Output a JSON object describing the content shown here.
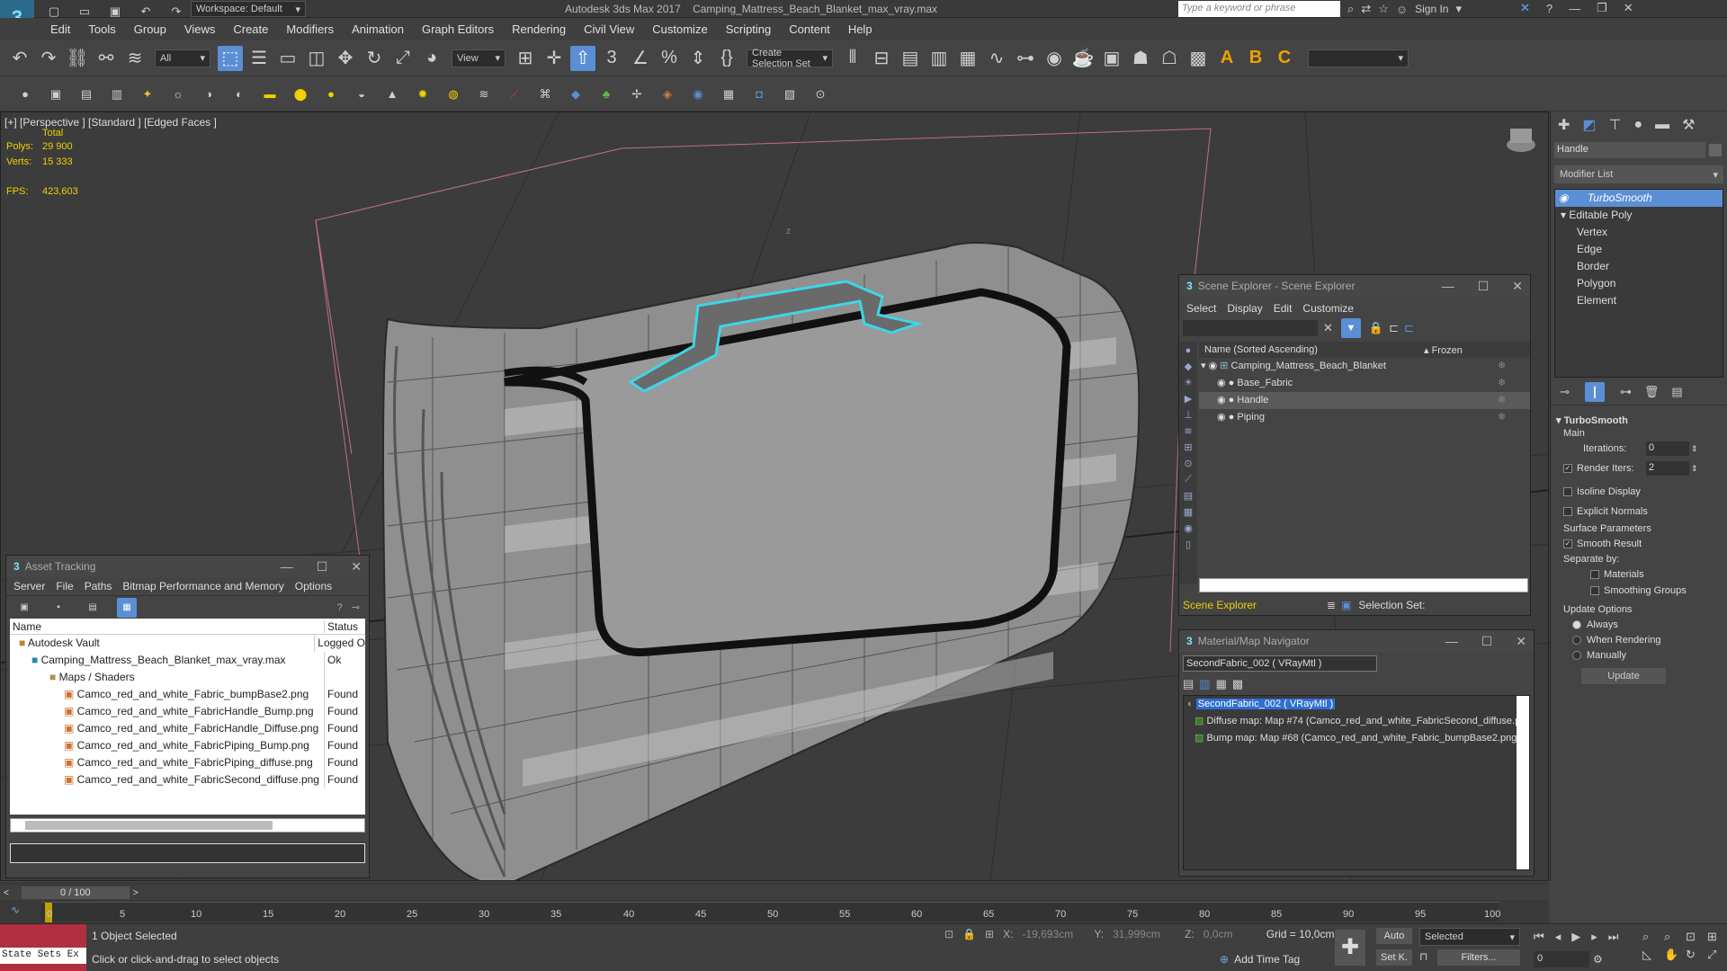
{
  "titlebar": {
    "workspace": "Workspace: Default",
    "app_title": "Autodesk 3ds Max 2017",
    "file_title": "Camping_Mattress_Beach_Blanket_max_vray.max",
    "search_placeholder": "Type a keyword or phrase",
    "sign_in": "Sign In"
  },
  "menu": [
    "Edit",
    "Tools",
    "Group",
    "Views",
    "Create",
    "Modifiers",
    "Animation",
    "Graph Editors",
    "Rendering",
    "Civil View",
    "Customize",
    "Scripting",
    "Content",
    "Help"
  ],
  "toolbar": {
    "filter_select": "All",
    "ref_coord": "View",
    "selection_set": "Create Selection Set"
  },
  "viewport": {
    "label": "[+] [Perspective ] [Standard ] [Edged Faces ]",
    "total_label": "Total",
    "polys_label": "Polys:",
    "polys_value": "29 900",
    "verts_label": "Verts:",
    "verts_value": "15 333",
    "fps_label": "FPS:",
    "fps_value": "423,603"
  },
  "asset_tracking": {
    "title": "Asset Tracking",
    "menu": [
      "Server",
      "File",
      "Paths",
      "Bitmap Performance and Memory",
      "Options"
    ],
    "col_name": "Name",
    "col_status": "Status",
    "rows": [
      {
        "name": "Autodesk Vault",
        "status": "Logged O"
      },
      {
        "name": "Camping_Mattress_Beach_Blanket_max_vray.max",
        "status": "Ok"
      },
      {
        "name": "Maps / Shaders",
        "status": ""
      },
      {
        "name": "Camco_red_and_white_Fabric_bumpBase2.png",
        "status": "Found"
      },
      {
        "name": "Camco_red_and_white_FabricHandle_Bump.png",
        "status": "Found"
      },
      {
        "name": "Camco_red_and_white_FabricHandle_Diffuse.png",
        "status": "Found"
      },
      {
        "name": "Camco_red_and_white_FabricPiping_Bump.png",
        "status": "Found"
      },
      {
        "name": "Camco_red_and_white_FabricPiping_diffuse.png",
        "status": "Found"
      },
      {
        "name": "Camco_red_and_white_FabricSecond_diffuse.png",
        "status": "Found"
      }
    ]
  },
  "scene_explorer": {
    "title": "Scene Explorer - Scene Explorer",
    "menu": [
      "Select",
      "Display",
      "Edit",
      "Customize"
    ],
    "col_name": "Name (Sorted Ascending)",
    "col_frozen": "▴ Frozen",
    "items": [
      "Camping_Mattress_Beach_Blanket",
      "Base_Fabric",
      "Handle",
      "Piping"
    ],
    "footer_name": "Scene Explorer",
    "footer_set": "Selection Set:"
  },
  "material_navigator": {
    "title": "Material/Map Navigator",
    "current": "SecondFabric_002  ( VRayMtl )",
    "tree": [
      "SecondFabric_002  ( VRayMtl )",
      "Diffuse map: Map #74 (Camco_red_and_white_FabricSecond_diffuse.p",
      "Bump map: Map #68 (Camco_red_and_white_Fabric_bumpBase2.png)"
    ]
  },
  "command_panel": {
    "object_name": "Handle",
    "modifier_list": "Modifier List",
    "stack": [
      "TurboSmooth",
      "Editable Poly",
      "Vertex",
      "Edge",
      "Border",
      "Polygon",
      "Element"
    ],
    "rollout_title": "TurboSmooth",
    "main_label": "Main",
    "iterations_label": "Iterations:",
    "iterations_value": "0",
    "render_iters_label": "Render Iters:",
    "render_iters_value": "2",
    "isoline": "Isoline Display",
    "explicit_normals": "Explicit Normals",
    "surface_params": "Surface Parameters",
    "smooth_result": "Smooth Result",
    "separate_by": "Separate by:",
    "materials": "Materials",
    "smoothing_groups": "Smoothing Groups",
    "update_options": "Update Options",
    "always": "Always",
    "when_rendering": "When Rendering",
    "manually": "Manually",
    "update_button": "Update"
  },
  "timeline": {
    "frame": "0 / 100",
    "ticks": [
      "0",
      "5",
      "10",
      "15",
      "20",
      "25",
      "30",
      "35",
      "40",
      "45",
      "50",
      "55",
      "60",
      "65",
      "70",
      "75",
      "80",
      "85",
      "90",
      "95",
      "100"
    ]
  },
  "status": {
    "state_sets": "State Sets Ex",
    "selected": "1 Object Selected",
    "prompt": "Click or click-and-drag to select objects",
    "x_label": "X:",
    "x_value": "-19,693cm",
    "y_label": "Y:",
    "y_value": "31,999cm",
    "z_label": "Z:",
    "z_value": "0,0cm",
    "grid": "Grid = 10,0cm",
    "add_time_tag": "Add Time Tag",
    "auto": "Auto",
    "set_k": "Set K.",
    "selected_dd": "Selected",
    "filters": "Filters...",
    "frame_field": "0"
  },
  "colors": {
    "accent": "#5a8fd6",
    "selection_highlight": "#3cd6e8",
    "stats_yellow": "#f0d000"
  }
}
